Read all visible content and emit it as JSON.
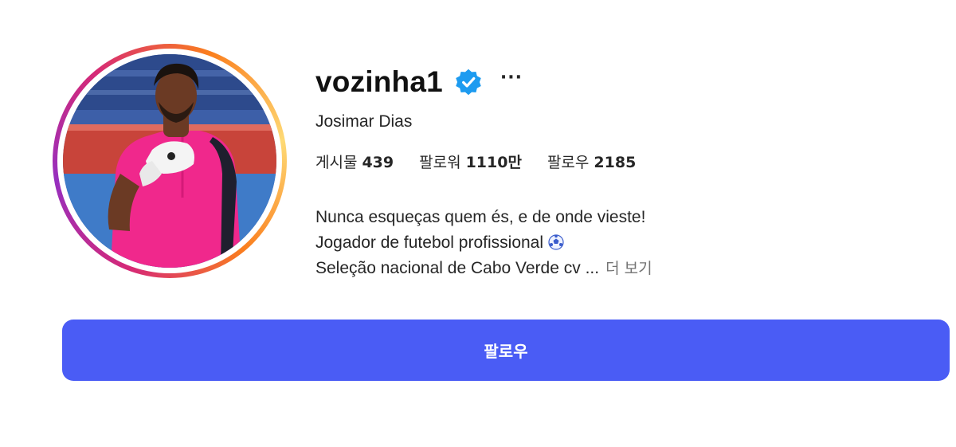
{
  "profile": {
    "username": "vozinha1",
    "full_name": "Josimar Dias",
    "verified_icon": "verified-badge-icon",
    "more_icon": "more-options-icon",
    "more_label": "···"
  },
  "stats": [
    {
      "label": "게시물",
      "value": "439"
    },
    {
      "label": "팔로워",
      "value": "1110만"
    },
    {
      "label": "팔로우",
      "value": "2185"
    }
  ],
  "bio": {
    "line1": "Nunca esqueças quem és, e de onde vieste!",
    "line2": "Jogador de futebol profissional",
    "line3": "Seleção nacional de Cabo Verde cv ...",
    "more_label": "더 보기"
  },
  "actions": {
    "follow_label": "팔로우"
  },
  "colors": {
    "accent": "#4a5cf5",
    "verified": "#1d9bf0",
    "muted": "#737373"
  }
}
